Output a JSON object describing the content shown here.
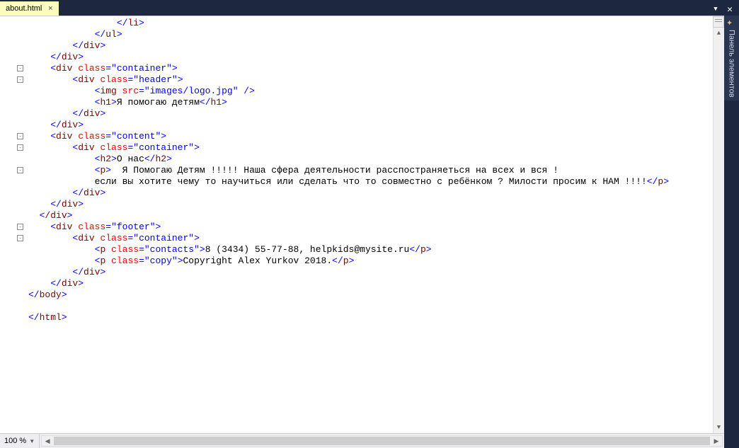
{
  "tab": {
    "filename": "about.html"
  },
  "side_panel": {
    "label": "Панель элементов"
  },
  "zoom": {
    "level": "100 %"
  },
  "fold_glyph": "-",
  "code": {
    "lines": [
      {
        "indent": 16,
        "tokens": [
          {
            "t": "delim",
            "v": "</"
          },
          {
            "t": "name",
            "v": "li"
          },
          {
            "t": "delim",
            "v": ">"
          }
        ]
      },
      {
        "indent": 12,
        "tokens": [
          {
            "t": "delim",
            "v": "</"
          },
          {
            "t": "name",
            "v": "ul"
          },
          {
            "t": "delim",
            "v": ">"
          }
        ]
      },
      {
        "indent": 8,
        "tokens": [
          {
            "t": "delim",
            "v": "</"
          },
          {
            "t": "name",
            "v": "div"
          },
          {
            "t": "delim",
            "v": ">"
          }
        ]
      },
      {
        "indent": 4,
        "tokens": [
          {
            "t": "delim",
            "v": "</"
          },
          {
            "t": "name",
            "v": "div"
          },
          {
            "t": "delim",
            "v": ">"
          }
        ]
      },
      {
        "indent": 4,
        "fold": true,
        "tokens": [
          {
            "t": "delim",
            "v": "<"
          },
          {
            "t": "name",
            "v": "div "
          },
          {
            "t": "attr",
            "v": "class"
          },
          {
            "t": "delim",
            "v": "=\""
          },
          {
            "t": "val",
            "v": "container"
          },
          {
            "t": "delim",
            "v": "\">"
          }
        ]
      },
      {
        "indent": 8,
        "fold": true,
        "tokens": [
          {
            "t": "delim",
            "v": "<"
          },
          {
            "t": "name",
            "v": "div "
          },
          {
            "t": "attr",
            "v": "class"
          },
          {
            "t": "delim",
            "v": "=\""
          },
          {
            "t": "val",
            "v": "header"
          },
          {
            "t": "delim",
            "v": "\">"
          }
        ]
      },
      {
        "indent": 12,
        "tokens": [
          {
            "t": "delim",
            "v": "<"
          },
          {
            "t": "name",
            "v": "img "
          },
          {
            "t": "attr",
            "v": "src"
          },
          {
            "t": "delim",
            "v": "=\""
          },
          {
            "t": "val",
            "v": "images/logo.jpg"
          },
          {
            "t": "delim",
            "v": "\" />"
          }
        ]
      },
      {
        "indent": 12,
        "tokens": [
          {
            "t": "delim",
            "v": "<"
          },
          {
            "t": "name",
            "v": "h1"
          },
          {
            "t": "delim",
            "v": ">"
          },
          {
            "t": "txt",
            "v": "Я помогаю детям"
          },
          {
            "t": "delim",
            "v": "</"
          },
          {
            "t": "name",
            "v": "h1"
          },
          {
            "t": "delim",
            "v": ">"
          }
        ]
      },
      {
        "indent": 8,
        "tokens": [
          {
            "t": "delim",
            "v": "</"
          },
          {
            "t": "name",
            "v": "div"
          },
          {
            "t": "delim",
            "v": ">"
          }
        ]
      },
      {
        "indent": 4,
        "tokens": [
          {
            "t": "delim",
            "v": "</"
          },
          {
            "t": "name",
            "v": "div"
          },
          {
            "t": "delim",
            "v": ">"
          }
        ]
      },
      {
        "indent": 4,
        "fold": true,
        "tokens": [
          {
            "t": "delim",
            "v": "<"
          },
          {
            "t": "name",
            "v": "div "
          },
          {
            "t": "attr",
            "v": "class"
          },
          {
            "t": "delim",
            "v": "=\""
          },
          {
            "t": "val",
            "v": "content"
          },
          {
            "t": "delim",
            "v": "\">"
          }
        ]
      },
      {
        "indent": 8,
        "fold": true,
        "tokens": [
          {
            "t": "delim",
            "v": "<"
          },
          {
            "t": "name",
            "v": "div "
          },
          {
            "t": "attr",
            "v": "class"
          },
          {
            "t": "delim",
            "v": "=\""
          },
          {
            "t": "val",
            "v": "container"
          },
          {
            "t": "delim",
            "v": "\">"
          }
        ]
      },
      {
        "indent": 12,
        "tokens": [
          {
            "t": "delim",
            "v": "<"
          },
          {
            "t": "name",
            "v": "h2"
          },
          {
            "t": "delim",
            "v": ">"
          },
          {
            "t": "txt",
            "v": "О нас"
          },
          {
            "t": "delim",
            "v": "</"
          },
          {
            "t": "name",
            "v": "h2"
          },
          {
            "t": "delim",
            "v": ">"
          }
        ]
      },
      {
        "indent": 12,
        "fold": true,
        "tokens": [
          {
            "t": "delim",
            "v": "<"
          },
          {
            "t": "name",
            "v": "p"
          },
          {
            "t": "delim",
            "v": ">"
          },
          {
            "t": "txt",
            "v": "  Я Помогаю Детям !!!!! Наша сфера деятельности расспостраняеться на всех и вся !"
          }
        ]
      },
      {
        "indent": 12,
        "tokens": [
          {
            "t": "txt",
            "v": "если вы хотите чему то научиться или сделать что то совместно с ребёнком ? Милости просим к НАМ !!!!"
          },
          {
            "t": "delim",
            "v": "</"
          },
          {
            "t": "name",
            "v": "p"
          },
          {
            "t": "delim",
            "v": ">"
          }
        ]
      },
      {
        "indent": 8,
        "tokens": [
          {
            "t": "delim",
            "v": "</"
          },
          {
            "t": "name",
            "v": "div"
          },
          {
            "t": "delim",
            "v": ">"
          }
        ]
      },
      {
        "indent": 4,
        "tokens": [
          {
            "t": "delim",
            "v": "</"
          },
          {
            "t": "name",
            "v": "div"
          },
          {
            "t": "delim",
            "v": ">"
          }
        ]
      },
      {
        "indent": 2,
        "tokens": [
          {
            "t": "delim",
            "v": "<"
          },
          {
            "t": "name",
            "v": "/div"
          },
          {
            "t": "delim",
            "v": ">"
          }
        ]
      },
      {
        "indent": 4,
        "fold": true,
        "tokens": [
          {
            "t": "delim",
            "v": "<"
          },
          {
            "t": "name",
            "v": "div "
          },
          {
            "t": "attr",
            "v": "class"
          },
          {
            "t": "delim",
            "v": "=\""
          },
          {
            "t": "val",
            "v": "footer"
          },
          {
            "t": "delim",
            "v": "\">"
          }
        ]
      },
      {
        "indent": 8,
        "fold": true,
        "tokens": [
          {
            "t": "delim",
            "v": "<"
          },
          {
            "t": "name",
            "v": "div "
          },
          {
            "t": "attr",
            "v": "class"
          },
          {
            "t": "delim",
            "v": "=\""
          },
          {
            "t": "val",
            "v": "container"
          },
          {
            "t": "delim",
            "v": "\">"
          }
        ]
      },
      {
        "indent": 12,
        "tokens": [
          {
            "t": "delim",
            "v": "<"
          },
          {
            "t": "name",
            "v": "p "
          },
          {
            "t": "attr",
            "v": "class"
          },
          {
            "t": "delim",
            "v": "=\""
          },
          {
            "t": "val",
            "v": "contacts"
          },
          {
            "t": "delim",
            "v": "\">"
          },
          {
            "t": "txt",
            "v": "8 (3434) 55-77-88, helpkids@mysite.ru"
          },
          {
            "t": "delim",
            "v": "</"
          },
          {
            "t": "name",
            "v": "p"
          },
          {
            "t": "delim",
            "v": ">"
          }
        ]
      },
      {
        "indent": 12,
        "tokens": [
          {
            "t": "delim",
            "v": "<"
          },
          {
            "t": "name",
            "v": "p "
          },
          {
            "t": "attr",
            "v": "class"
          },
          {
            "t": "delim",
            "v": "=\""
          },
          {
            "t": "val",
            "v": "copy"
          },
          {
            "t": "delim",
            "v": "\">"
          },
          {
            "t": "txt",
            "v": "Copyright Alex Yurkov 2018."
          },
          {
            "t": "delim",
            "v": "</"
          },
          {
            "t": "name",
            "v": "p"
          },
          {
            "t": "delim",
            "v": ">"
          }
        ]
      },
      {
        "indent": 8,
        "tokens": [
          {
            "t": "delim",
            "v": "</"
          },
          {
            "t": "name",
            "v": "div"
          },
          {
            "t": "delim",
            "v": ">"
          }
        ]
      },
      {
        "indent": 4,
        "tokens": [
          {
            "t": "delim",
            "v": "</"
          },
          {
            "t": "name",
            "v": "div"
          },
          {
            "t": "delim",
            "v": ">"
          }
        ]
      },
      {
        "indent": 0,
        "tokens": [
          {
            "t": "delim",
            "v": "</"
          },
          {
            "t": "name",
            "v": "body"
          },
          {
            "t": "delim",
            "v": ">"
          }
        ]
      },
      {
        "indent": 0,
        "tokens": []
      },
      {
        "indent": 0,
        "tokens": [
          {
            "t": "delim",
            "v": "</"
          },
          {
            "t": "name",
            "v": "html"
          },
          {
            "t": "delim",
            "v": ">"
          }
        ]
      }
    ]
  }
}
